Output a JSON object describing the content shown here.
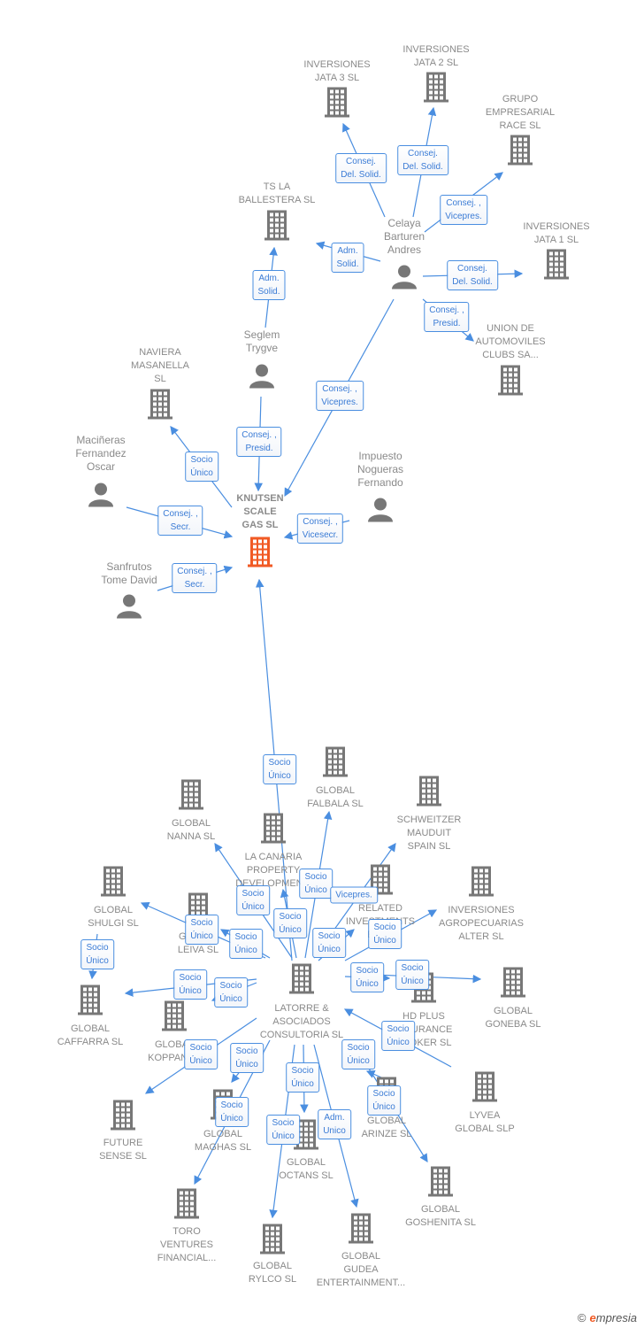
{
  "colors": {
    "main_company": "#f15a24",
    "company": "#777777",
    "person": "#777777",
    "edge": "#4a8ee0"
  },
  "nodes": [
    {
      "id": "knutsen",
      "label": "KNUTSEN\nSCALE\nGAS  SL",
      "type": "company",
      "main": true
    },
    {
      "id": "jata3",
      "label": "INVERSIONES\nJATA 3 SL",
      "type": "company"
    },
    {
      "id": "jata2",
      "label": "INVERSIONES\nJATA 2 SL",
      "type": "company"
    },
    {
      "id": "grupo",
      "label": "GRUPO\nEMPRESARIAL\nRACE SL",
      "type": "company"
    },
    {
      "id": "tsla",
      "label": "TS LA\nBALLESTERA SL",
      "type": "company"
    },
    {
      "id": "jata1",
      "label": "INVERSIONES\nJATA 1 SL",
      "type": "company"
    },
    {
      "id": "union",
      "label": "UNION DE\nAUTOMOVILES\nCLUBS SA...",
      "type": "company"
    },
    {
      "id": "celaya",
      "label": "Celaya\nBarturen\nAndres",
      "type": "person"
    },
    {
      "id": "seglem",
      "label": "Seglem\nTrygve",
      "type": "person"
    },
    {
      "id": "naviera",
      "label": "NAVIERA\nMASANELLA\nSL",
      "type": "company"
    },
    {
      "id": "macineras",
      "label": "Maciñeras\nFernandez\nOscar",
      "type": "person"
    },
    {
      "id": "impuesto",
      "label": "Impuesto\nNogueras\nFernando",
      "type": "person"
    },
    {
      "id": "sanfrutos",
      "label": "Sanfrutos\nTome David",
      "type": "person"
    },
    {
      "id": "latorre",
      "label": "LATORRE &\nASOCIADOS\nCONSULTORIA SL",
      "type": "company"
    },
    {
      "id": "falbala",
      "label": "GLOBAL\nFALBALA  SL",
      "type": "company"
    },
    {
      "id": "nanna",
      "label": "GLOBAL\nNANNA  SL",
      "type": "company"
    },
    {
      "id": "schweitzer",
      "label": "SCHWEITZER\nMAUDUIT\nSPAIN SL",
      "type": "company"
    },
    {
      "id": "canaria",
      "label": "LA CANARIA\nPROPERTY\nDEVELOPMEN...",
      "type": "company"
    },
    {
      "id": "shulgi",
      "label": "GLOBAL\nSHULGI  SL",
      "type": "company"
    },
    {
      "id": "related",
      "label": "RELATED\nINVESTMENTS\nESP...",
      "type": "company"
    },
    {
      "id": "agro",
      "label": "INVERSIONES\nAGROPECUARIAS\nALTER  SL",
      "type": "company"
    },
    {
      "id": "leiva",
      "label": "GLOBAL\nLEIVA  SL",
      "type": "company"
    },
    {
      "id": "caffarra",
      "label": "GLOBAL\nCAFFARRA  SL",
      "type": "company"
    },
    {
      "id": "koppant",
      "label": "GLOBAL\nKOPPANT...",
      "type": "company"
    },
    {
      "id": "hdplus",
      "label": "HD PLUS\nINSURANCE\nBROKER  SL",
      "type": "company"
    },
    {
      "id": "goneba",
      "label": "GLOBAL\nGONEBA  SL",
      "type": "company"
    },
    {
      "id": "lyvea",
      "label": "LYVEA\nGLOBAL  SLP",
      "type": "company"
    },
    {
      "id": "future",
      "label": "FUTURE\nSENSE  SL",
      "type": "company"
    },
    {
      "id": "maghas",
      "label": "GLOBAL\nMAGHAS  SL",
      "type": "company"
    },
    {
      "id": "arinze",
      "label": "GLOBAL\nARINZE  SL",
      "type": "company"
    },
    {
      "id": "octans",
      "label": "GLOBAL\nOCTANS  SL",
      "type": "company"
    },
    {
      "id": "goshenita",
      "label": "GLOBAL\nGOSHENITA SL",
      "type": "company"
    },
    {
      "id": "toro",
      "label": "TORO\nVENTURES\nFINANCIAL...",
      "type": "company"
    },
    {
      "id": "rylco",
      "label": "GLOBAL\nRYLCO  SL",
      "type": "company"
    },
    {
      "id": "gudea",
      "label": "GLOBAL\nGUDEA\nENTERTAINMENT...",
      "type": "company"
    }
  ],
  "edges": [
    {
      "label": "Consej.\nDel. Solid."
    },
    {
      "label": "Consej.\nDel. Solid."
    },
    {
      "label": "Consej. ,\nVicepres."
    },
    {
      "label": "Adm.\nSolid."
    },
    {
      "label": "Consej.\nDel. Solid."
    },
    {
      "label": "Consej. ,\nPresid."
    },
    {
      "label": "Adm.\nSolid."
    },
    {
      "label": "Consej. ,\nVicepres."
    },
    {
      "label": "Consej. ,\nPresid."
    },
    {
      "label": "Socio\nÚnico"
    },
    {
      "label": "Consej. ,\nSecr."
    },
    {
      "label": "Consej. ,\nVicesecr."
    },
    {
      "label": "Consej. ,\nSecr."
    },
    {
      "label": "Socio\nÚnico"
    },
    {
      "label": "Socio\nÚnico"
    },
    {
      "label": "Vicepres."
    },
    {
      "label": "Socio\nÚnico"
    },
    {
      "label": "Socio\nÚnico"
    },
    {
      "label": "Socio\nÚnico"
    },
    {
      "label": "Socio\nÚnico"
    },
    {
      "label": "Socio\nÚnico"
    },
    {
      "label": "Socio\nÚnico"
    },
    {
      "label": "Socio\nÚnico"
    },
    {
      "label": "Socio\nÚnico"
    },
    {
      "label": "Socio\nÚnico"
    },
    {
      "label": "Socio\nÚnico"
    },
    {
      "label": "Socio\nÚnico"
    },
    {
      "label": "Socio\nÚnico"
    },
    {
      "label": "Socio\nÚnico"
    },
    {
      "label": "Socio\nÚnico"
    },
    {
      "label": "Socio\nÚnico"
    },
    {
      "label": "Socio\nÚnico"
    },
    {
      "label": "Socio\nÚnico"
    },
    {
      "label": "Socio\nÚnico"
    },
    {
      "label": "Socio\nÚnico"
    },
    {
      "label": "Adm.\nUnico"
    }
  ],
  "footer": {
    "copyright": "©",
    "brand_first": "e",
    "brand_rest": "mpresia"
  }
}
